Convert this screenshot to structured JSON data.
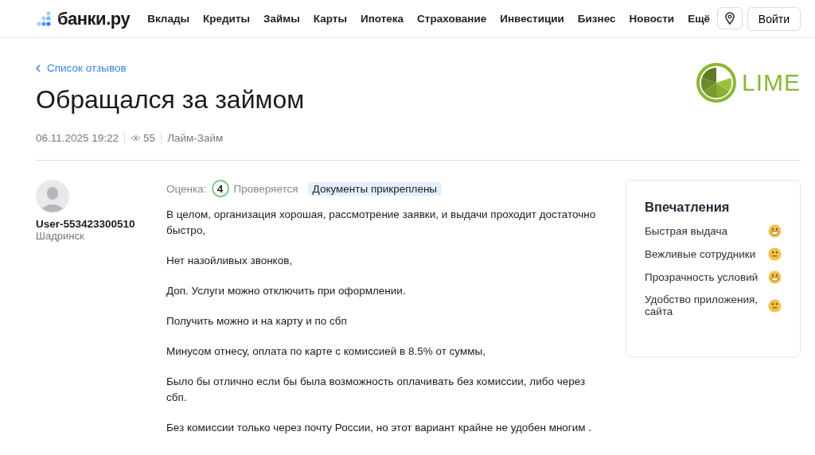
{
  "header": {
    "logo": "банки.ру",
    "nav": [
      "Вклады",
      "Кредиты",
      "Займы",
      "Карты",
      "Ипотека",
      "Страхование",
      "Инвестиции",
      "Бизнес",
      "Новости",
      "Ещё"
    ],
    "login": "Войти"
  },
  "back_link": "Список отзывов",
  "title": "Обращался за займом",
  "meta": {
    "date": "06.11.2025 19:22",
    "views": "55",
    "company": "Лайм-Займ"
  },
  "brand_logo": "LIME",
  "author": {
    "name": "User-553423300510",
    "city": "Шадринск"
  },
  "review": {
    "rating_label": "Оценка:",
    "rating": "4",
    "status": "Проверяется",
    "tag": "Документы прикреплены",
    "paragraphs": [
      "В целом, организация хорошая, рассмотрение заявки, и выдачи проходит достаточно быстро,",
      "Нет назойливых звонков,",
      "Доп. Услуги можно отключить при оформлении.",
      "Получить можно и на карту и по сбп",
      "Минусом отнесу, оплата по карте с комиссией в 8.5% от суммы,",
      "Было бы отлично если бы была возможность оплачивать без комиссии, либо через сбп.",
      "Без комиссии только через почту России, но этот вариант крайне не удобен многим ."
    ]
  },
  "impressions": {
    "title": "Впечатления",
    "items": [
      {
        "label": "Быстрая выдача",
        "kind": "grin"
      },
      {
        "label": "Вежливые сотрудники",
        "kind": "neutral"
      },
      {
        "label": "Прозрачность условий",
        "kind": "grin"
      },
      {
        "label": "Удобство приложения, сайта",
        "kind": "neutral"
      }
    ]
  }
}
